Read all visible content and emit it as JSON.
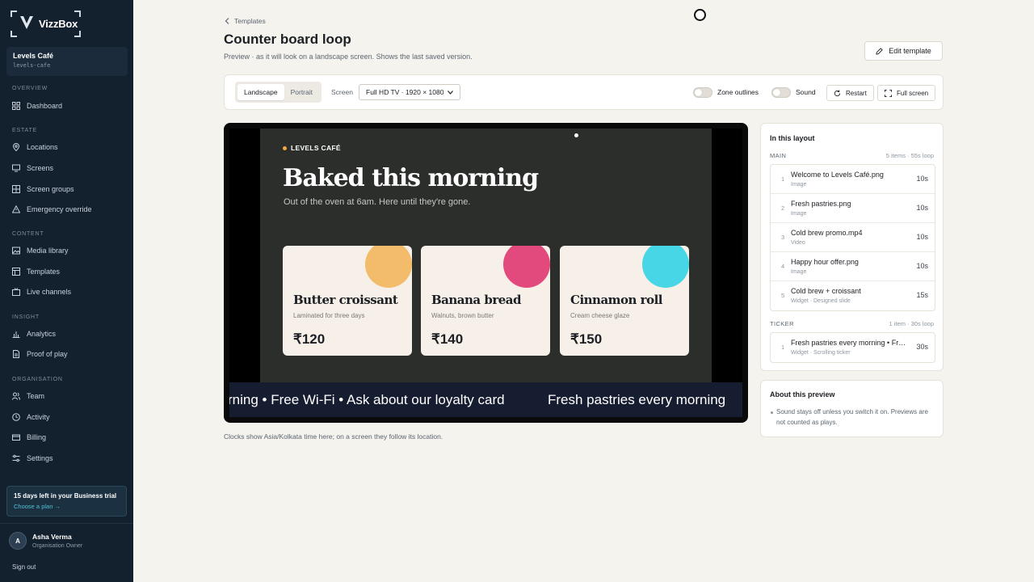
{
  "brand": {
    "name": "VizzBox"
  },
  "org": {
    "name": "Levels Café",
    "slug": "levels-cafe"
  },
  "nav": {
    "overview": "OVERVIEW",
    "estate": "ESTATE",
    "content": "CONTENT",
    "insight": "INSIGHT",
    "organisation": "ORGANISATION",
    "items": {
      "dashboard": "Dashboard",
      "locations": "Locations",
      "screens": "Screens",
      "screen_groups": "Screen groups",
      "emergency_override": "Emergency override",
      "media_library": "Media library",
      "templates": "Templates",
      "live_channels": "Live channels",
      "analytics": "Analytics",
      "proof_of_play": "Proof of play",
      "team": "Team",
      "activity": "Activity",
      "billing": "Billing",
      "settings": "Settings"
    }
  },
  "trial": {
    "title": "15 days left in your Business trial",
    "link": "Choose a plan →"
  },
  "user": {
    "initial": "A",
    "name": "Asha Verma",
    "role": "Organisation Owner",
    "signout": "Sign out"
  },
  "header": {
    "breadcrumb": "Templates",
    "title": "Counter board loop",
    "subtitle": "Preview · as it will look on a landscape screen. Shows the last saved version.",
    "edit_button": "Edit template"
  },
  "toolbar": {
    "orientation": [
      "Landscape",
      "Portrait"
    ],
    "screen_label": "Screen",
    "screen_value": "Full HD TV · 1920 × 1080",
    "zone_outlines": "Zone outlines",
    "sound": "Sound",
    "restart": "Restart",
    "full_screen": "Full screen"
  },
  "slide": {
    "brand": "LEVELS CAFÉ",
    "headline": "Baked this morning",
    "subhead": "Out of the oven at 6am. Here until they're gone.",
    "cards": [
      {
        "name": "Butter croissant",
        "desc": "Laminated for three days",
        "price": "₹120",
        "color": "#f2bc6a"
      },
      {
        "name": "Banana bread",
        "desc": "Walnuts, brown butter",
        "price": "₹140",
        "color": "#e2497d"
      },
      {
        "name": "Cinnamon roll",
        "desc": "Cream cheese glaze",
        "price": "₹150",
        "color": "#47d6e6"
      }
    ],
    "ticker_a": "rning • Free Wi-Fi • Ask about our loyalty card",
    "ticker_b": "Fresh pastries every morning"
  },
  "caption": "Clocks show Asia/Kolkata time here; on a screen they follow its location.",
  "layout_panel": {
    "title": "In this layout",
    "main_label": "MAIN",
    "main_meta": "5 items · 55s loop",
    "main_items": [
      {
        "idx": "1",
        "name": "Welcome to Levels Café.png",
        "type": "Image",
        "dur": "10s"
      },
      {
        "idx": "2",
        "name": "Fresh pastries.png",
        "type": "Image",
        "dur": "10s"
      },
      {
        "idx": "3",
        "name": "Cold brew promo.mp4",
        "type": "Video",
        "dur": "10s"
      },
      {
        "idx": "4",
        "name": "Happy hour offer.png",
        "type": "Image",
        "dur": "10s"
      },
      {
        "idx": "5",
        "name": "Cold brew + croissant",
        "type": "Widget · Designed slide",
        "dur": "15s"
      }
    ],
    "ticker_label": "TICKER",
    "ticker_meta": "1 item · 30s loop",
    "ticker_items": [
      {
        "idx": "1",
        "name": "Fresh pastries every morning • Free Wi-Fi",
        "type": "Widget · Scrolling ticker",
        "dur": "30s"
      }
    ]
  },
  "about": {
    "title": "About this preview",
    "body": "Sound stays off unless you switch it on. Previews are not counted as plays."
  }
}
